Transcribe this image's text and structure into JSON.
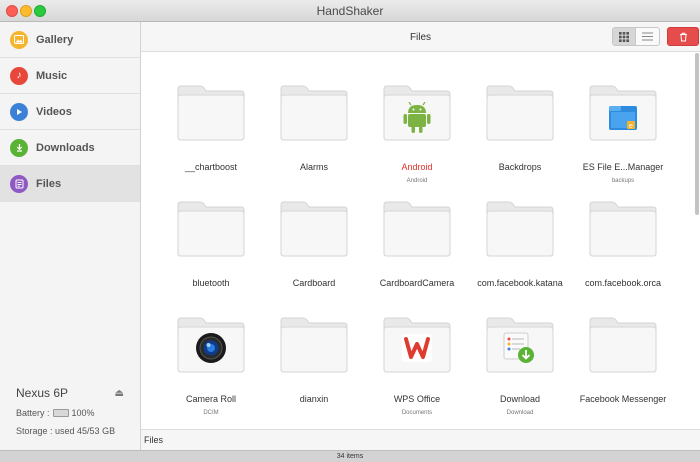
{
  "window": {
    "title": "HandShaker"
  },
  "sidebar": {
    "items": [
      {
        "label": "Gallery",
        "icon": "gallery-icon",
        "color": "#f5b52e"
      },
      {
        "label": "Music",
        "icon": "music-note-icon",
        "color": "#e8473c"
      },
      {
        "label": "Videos",
        "icon": "play-icon",
        "color": "#3b82d6"
      },
      {
        "label": "Downloads",
        "icon": "download-arrow-icon",
        "color": "#5bb335"
      },
      {
        "label": "Files",
        "icon": "files-icon",
        "color": "#8e5ac2"
      }
    ],
    "active": "Files"
  },
  "device": {
    "name": "Nexus 6P",
    "battery_label": "Battery :",
    "battery_value": "100%",
    "storage": "Storage : used 45/53 GB"
  },
  "toolbar": {
    "title": "Files"
  },
  "folders": [
    {
      "name": "__chartboost",
      "sub": "",
      "badge": ""
    },
    {
      "name": "Alarms",
      "sub": "",
      "badge": ""
    },
    {
      "name": "Android",
      "sub": "Android",
      "badge": "android-robot-icon",
      "highlight": true
    },
    {
      "name": "Backdrops",
      "sub": "",
      "badge": ""
    },
    {
      "name": "ES File E...Manager",
      "sub": "backups",
      "badge": "es-file-explorer-icon"
    },
    {
      "name": "bluetooth",
      "sub": "",
      "badge": ""
    },
    {
      "name": "Cardboard",
      "sub": "",
      "badge": ""
    },
    {
      "name": "CardboardCamera",
      "sub": "",
      "badge": ""
    },
    {
      "name": "com.facebook.katana",
      "sub": "",
      "badge": ""
    },
    {
      "name": "com.facebook.orca",
      "sub": "",
      "badge": ""
    },
    {
      "name": "Camera Roll",
      "sub": "DCIM",
      "badge": "camera-lens-icon"
    },
    {
      "name": "dianxin",
      "sub": "",
      "badge": ""
    },
    {
      "name": "WPS Office",
      "sub": "Documents",
      "badge": "wps-office-icon"
    },
    {
      "name": "Download",
      "sub": "Download",
      "badge": "download-folder-icon"
    },
    {
      "name": "Facebook Messenger",
      "sub": "",
      "badge": ""
    }
  ],
  "pathbar": {
    "path": "Files"
  },
  "status": {
    "count": "34 items"
  }
}
